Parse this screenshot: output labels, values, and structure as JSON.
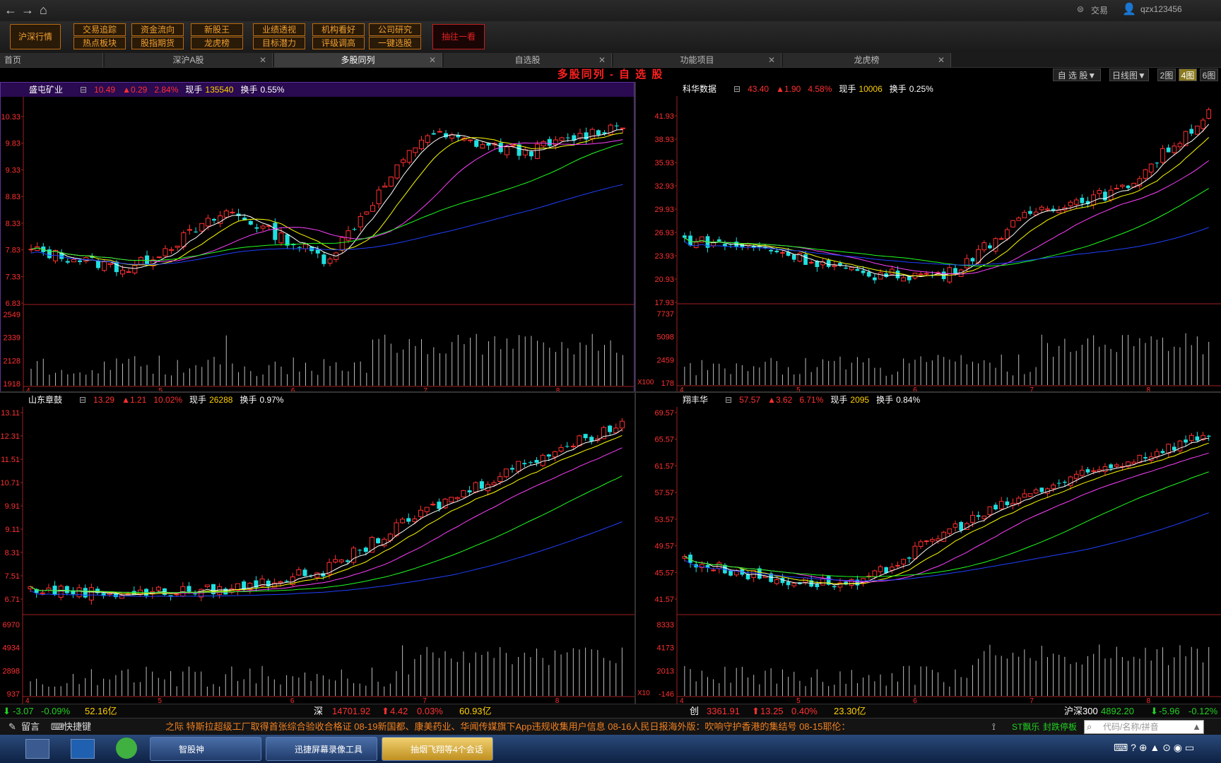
{
  "nav": {
    "back": "←",
    "forward": "→",
    "home": "⌂"
  },
  "user": {
    "trade_label": "交易",
    "username": "qzx123456"
  },
  "toolbar": {
    "market_btn": "沪深行情",
    "row1": [
      "交易追踪",
      "资金流向",
      "新股王",
      "业绩透视",
      "机构看好",
      "公司研究"
    ],
    "row2": [
      "热点板块",
      "股指期货",
      "龙虎榜",
      "目标潜力",
      "评级调高",
      "一键选股"
    ],
    "last_btn": "抽往一看"
  },
  "tabs": [
    {
      "label": "首页"
    },
    {
      "label": "深沪A股",
      "close": "✕"
    },
    {
      "label": "多股同列",
      "close": "✕"
    },
    {
      "label": "自选股",
      "close": "✕"
    },
    {
      "label": "功能项目",
      "close": "✕"
    },
    {
      "label": "龙虎榜",
      "close": "✕"
    }
  ],
  "title": "多股同列 - 自 选 股",
  "view": {
    "sel": "自 选 股▼",
    "period": "日线图▼",
    "g2": "2图",
    "g4": "4图",
    "g6": "6图"
  },
  "panels": [
    {
      "name": "盛屯矿业",
      "price": "10.49",
      "chg": "▲0.29",
      "pct": "2.84%",
      "vol_label": "现手",
      "vol": "135540",
      "turn_label": "换手",
      "turn": "0.55%",
      "y": [
        "10.33",
        "9.83",
        "9.33",
        "8.83",
        "8.33",
        "7.83",
        "7.33",
        "6.83"
      ],
      "vy": [
        "2549",
        "2339",
        "2128",
        "1918"
      ],
      "x": [
        "4",
        "5",
        "6",
        "7",
        "8"
      ]
    },
    {
      "name": "科华数据",
      "price": "43.40",
      "chg": "▲1.90",
      "pct": "4.58%",
      "vol_label": "现手",
      "vol": "10006",
      "turn_label": "换手",
      "turn": "0.25%",
      "y": [
        "41.93",
        "38.93",
        "35.93",
        "32.93",
        "29.93",
        "26.93",
        "23.93",
        "20.93",
        "17.93"
      ],
      "vy": [
        "7737",
        "5098",
        "2459",
        "178"
      ],
      "x": [
        "4",
        "5",
        "6",
        "7",
        "8"
      ],
      "unit": "X100"
    },
    {
      "name": "山东章鼓",
      "price": "13.29",
      "chg": "▲1.21",
      "pct": "10.02%",
      "vol_label": "现手",
      "vol": "26288",
      "turn_label": "换手",
      "turn": "0.97%",
      "y": [
        "13.11",
        "12.31",
        "11.51",
        "10.71",
        "9.91",
        "9.11",
        "8.31",
        "7.51",
        "6.71"
      ],
      "vy": [
        "6970",
        "4934",
        "2898",
        "937"
      ],
      "x": [
        "4",
        "5",
        "6",
        "7",
        "8"
      ]
    },
    {
      "name": "翔丰华",
      "price": "57.57",
      "chg": "▲3.62",
      "pct": "6.71%",
      "vol_label": "现手",
      "vol": "2095",
      "turn_label": "换手",
      "turn": "0.84%",
      "y": [
        "69.57",
        "65.57",
        "61.57",
        "57.57",
        "53.57",
        "49.57",
        "45.57",
        "41.57"
      ],
      "vy": [
        "8333",
        "4173",
        "2013",
        "-146"
      ],
      "x": [
        "4",
        "5",
        "6",
        "7",
        "8"
      ],
      "unit": "X10"
    }
  ],
  "status": {
    "sh_chg": "-3.07",
    "sh_pct": "-0.09%",
    "sh_amt": "52.16亿",
    "sz_label": "深",
    "sz_val": "14701.92",
    "sz_chg": "4.42",
    "sz_pct": "0.03%",
    "sz_amt": "60.93亿",
    "cy_label": "创",
    "cy_val": "3361.91",
    "cy_chg": "13.25",
    "cy_pct": "0.40%",
    "cy_amt": "23.30亿",
    "hs_label": "沪深300",
    "hs_val": "4892.20",
    "hs_chg": "-5.96",
    "hs_pct": "-0.12%"
  },
  "bottom": {
    "msg": "留言",
    "hotkey": "快捷键",
    "news": "之际 特斯拉超级工厂取得首张综合验收合格证    08-19新国都、康美药业、华闻传媒旗下App违规收集用户信息    08-16人民日报海外版：吹响守护香港的集结号    08-15耶伦：",
    "st1": "ST飘乐",
    "st2": "封跌停板",
    "search_ph": "代码/名称/拼音"
  },
  "taskbar": {
    "t1": "智股神",
    "t2": "迅捷屏幕录像工具",
    "t3": "抽烟飞翔等4个会话"
  },
  "colors": {
    "up": "#ff3030",
    "down": "#20e0e0",
    "ma5": "#ffffff",
    "ma10": "#ffff00",
    "ma20": "#ff40ff",
    "ma60": "#20ff20",
    "ma120": "#2040ff"
  }
}
